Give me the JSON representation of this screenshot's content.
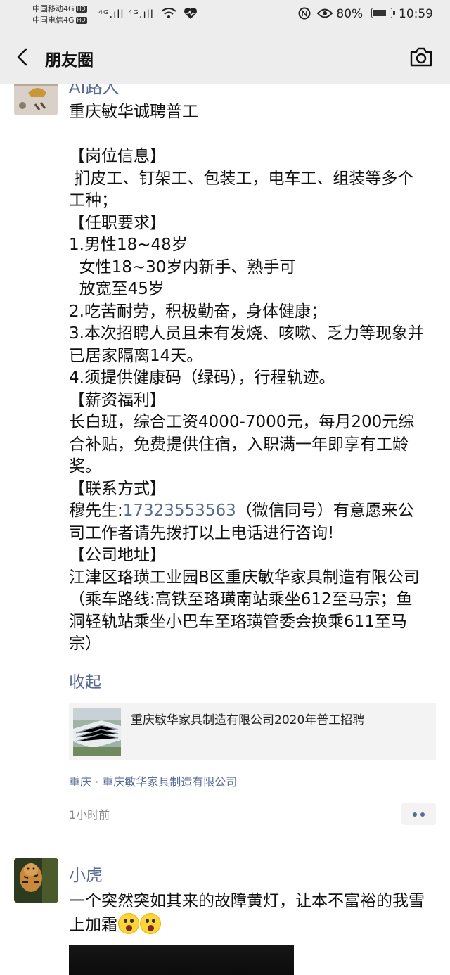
{
  "status_bar": {
    "carrier1": "中国移动4G",
    "carrier2": "中国电信4G",
    "hd_badge": "HD",
    "signal_text": "⁴ᴳ.ıll ⁴ᴳ.ıll",
    "battery_percent": "80%",
    "battery_level": 0.8,
    "time": "10:59"
  },
  "nav": {
    "title": "朋友圈",
    "back_icon": "chevron-left-icon",
    "camera_icon": "camera-icon"
  },
  "post1": {
    "author": "AI路人",
    "text": "重庆敏华诚聘普工\n\n【岗位信息】\n 扪皮工、钉架工、包装工，电车工、组装等多个工种；\n【任职要求】\n1.男性18~48岁\n  女性18~30岁内新手、熟手可\n  放宽至45岁\n2.吃苦耐劳，积极勤奋，身体健康；\n3.本次招聘人员且未有发烧、咳嗽、乏力等现象并已居家隔离14天。\n4.须提供健康码（绿码），行程轨迹。\n【薪资福利】\n长白班，综合工资4000-7000元，每月200元综合补贴，免费提供住宿，入职满一年即享有工龄奖。\n【联系方式】\n穆先生:",
    "phone": "17323553563",
    "text_after_phone": "（微信同号）有意愿来公司工作者请先拨打以上电话进行咨询!\n【公司地址】\n江津区珞璜工业园B区重庆敏华家具制造有限公司（乘车路线:高铁至珞璜南站乘坐612至马宗；鱼洞轻轨站乘坐小巴车至珞璜管委会换乘611至马宗）",
    "collapse": "收起",
    "link_title": "重庆敏华家具制造有限公司2020年普工招聘",
    "location": "重庆 · 重庆敏华家具制造有限公司",
    "time": "1小时前"
  },
  "post2": {
    "author": "小虎",
    "text": "一个突然突如其来的故障黄灯，让本不富裕的我雪上加霜"
  },
  "colors": {
    "link_blue": "#576b95",
    "bar_bg": "#ededed",
    "card_bg": "#f3f3f3"
  }
}
